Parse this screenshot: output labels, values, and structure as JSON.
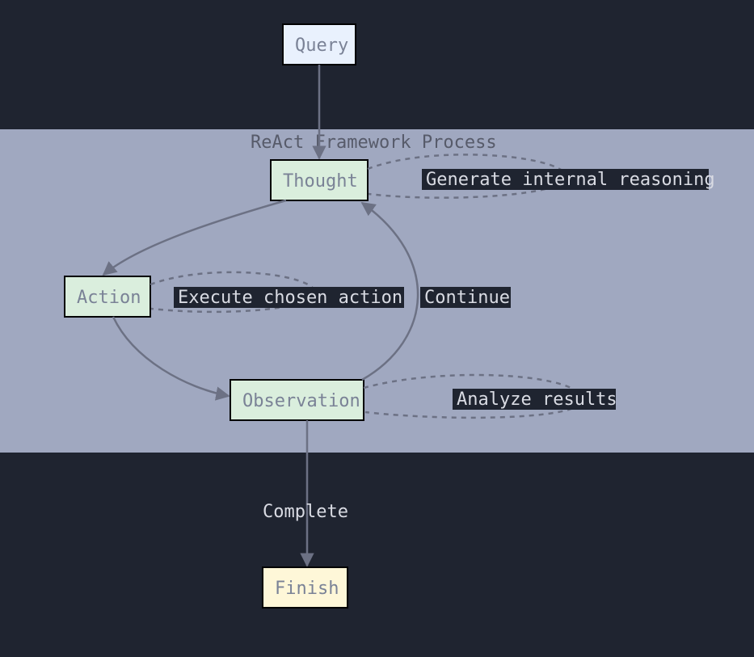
{
  "frame": {
    "title": "ReAct Framework Process"
  },
  "nodes": {
    "query": "Query",
    "thought": "Thought",
    "action": "Action",
    "observation": "Observation",
    "finish": "Finish"
  },
  "annotations": {
    "thought_note": "Generate internal reasoning",
    "action_note": "Execute chosen action",
    "observation_note": "Analyze results"
  },
  "edges": {
    "continue": "Continue",
    "complete": "Complete"
  },
  "colors": {
    "query_fill": "#e9f1fd",
    "process_fill": "#daeedd",
    "finish_fill": "#fef7d8"
  }
}
